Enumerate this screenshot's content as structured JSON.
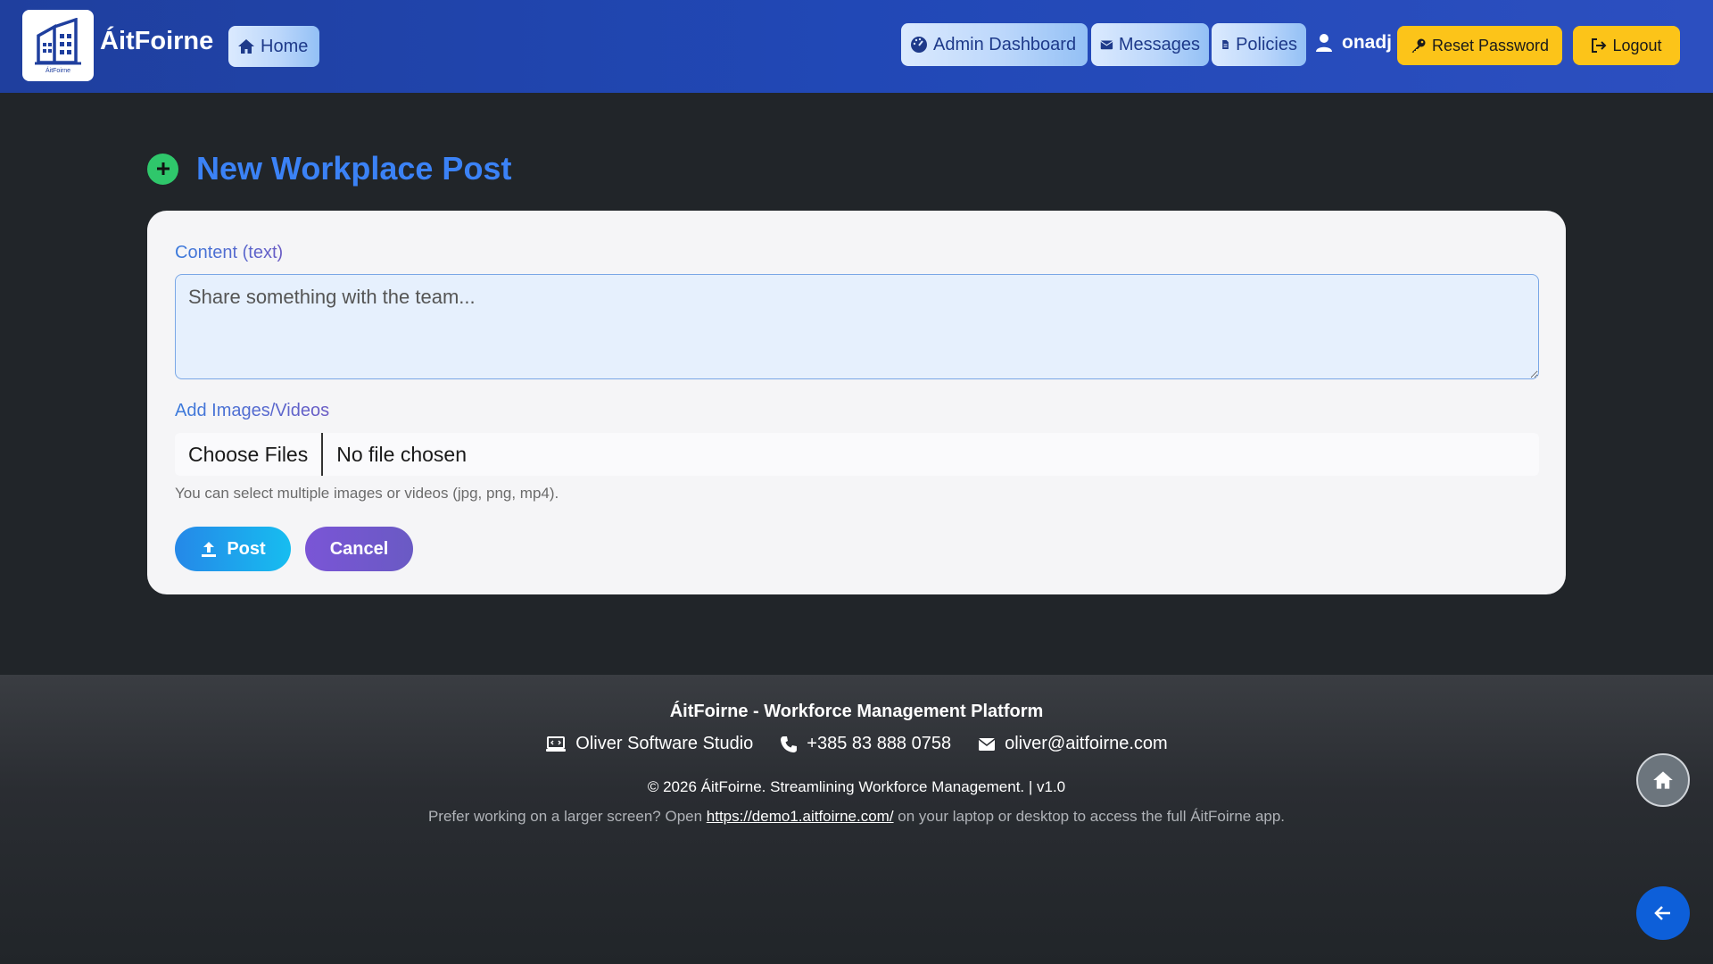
{
  "navbar": {
    "brand_name": "ÁitFoirne",
    "logo_subtext": "ÁitFoirne",
    "home_label": "Home",
    "admin_label": "Admin Dashboard",
    "messages_label": "Messages",
    "policies_label": "Policies",
    "username": "onadj",
    "reset_password_label": "Reset Password",
    "logout_label": "Logout"
  },
  "main": {
    "page_title": "New Workplace Post",
    "content_label": "Content (text)",
    "content_placeholder": "Share something with the team...",
    "media_label": "Add Images/Videos",
    "file_button_label": "Choose Files",
    "file_status": "No file chosen",
    "help_text": "You can select multiple images or videos (jpg, png, mp4).",
    "post_label": "Post",
    "cancel_label": "Cancel"
  },
  "footer": {
    "title": "ÁitFoirne - Workforce Management Platform",
    "company": "Oliver Software Studio",
    "phone": "+385 83 888 0758",
    "email": "oliver@aitfoirne.com",
    "copyright": "© 2026 ÁitFoirne. Streamlining Workforce Management. | v1.0",
    "note_prefix": "Prefer working on a larger screen? Open ",
    "note_link": "https://demo1.aitfoirne.com/",
    "note_suffix": " on your laptop or desktop to access the full ÁitFoirne app."
  },
  "colors": {
    "navbar": "#2148b6",
    "accent_blue": "#3b82f6",
    "yellow": "#fcc419",
    "green_plus": "#2fc76b",
    "background": "#212529"
  },
  "icons": {
    "home": "home-icon",
    "admin": "gauge-icon",
    "messages": "envelope-icon",
    "policies": "file-icon",
    "user": "user-icon",
    "reset": "key-icon",
    "logout": "logout-icon",
    "post": "upload-icon",
    "add": "plus-circle-icon",
    "laptop": "laptop-icon",
    "phone": "phone-icon",
    "email": "envelope-icon",
    "back": "arrow-left-icon"
  }
}
